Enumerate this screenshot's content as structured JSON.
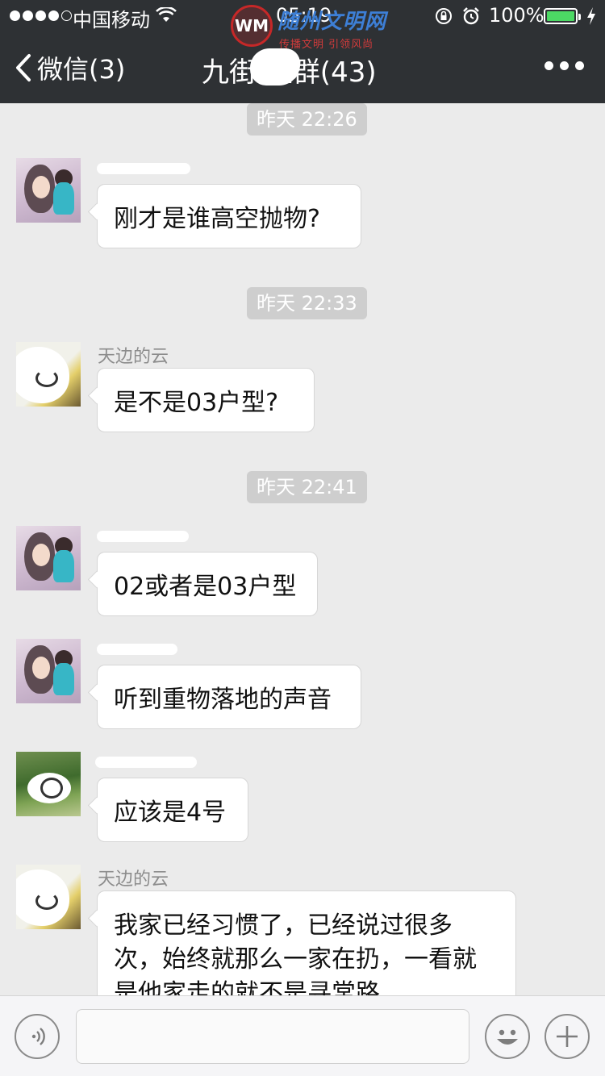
{
  "status_bar": {
    "carrier": "中国移动",
    "time": "05:19",
    "battery": "100%",
    "battery_level": 1.0
  },
  "watermark": {
    "logo_text": "WM",
    "title": "随州文明网",
    "subtitle": "传播文明  引领风尚"
  },
  "nav": {
    "back_label": "微信(3)",
    "title": "九街   座群(43)"
  },
  "messages": [
    {
      "timestamp": "昨天 22:26"
    },
    {
      "sender": "",
      "avatar": "girl-with-child",
      "text": "刚才是谁高空抛物?"
    },
    {
      "timestamp": "昨天 22:33"
    },
    {
      "sender": "天边的云",
      "avatar": "cloud-user",
      "text": "是不是03户型?"
    },
    {
      "timestamp": "昨天 22:41"
    },
    {
      "sender": "",
      "avatar": "girl-with-child",
      "text": "02或者是03户型"
    },
    {
      "sender": "",
      "avatar": "girl-with-child",
      "text": "听到重物落地的声音"
    },
    {
      "sender": "",
      "avatar": "green-scenery",
      "text": "应该是4号"
    },
    {
      "sender": "天边的云",
      "avatar": "cloud-user",
      "text": "我家已经习惯了，已经说过很多次，始终就那么一家在扔，一看就是他家走的就不是寻常路"
    }
  ],
  "input": {
    "voice_icon": "voice-icon",
    "emoji_icon": "emoji-icon",
    "plus_icon": "plus-icon",
    "value": ""
  }
}
